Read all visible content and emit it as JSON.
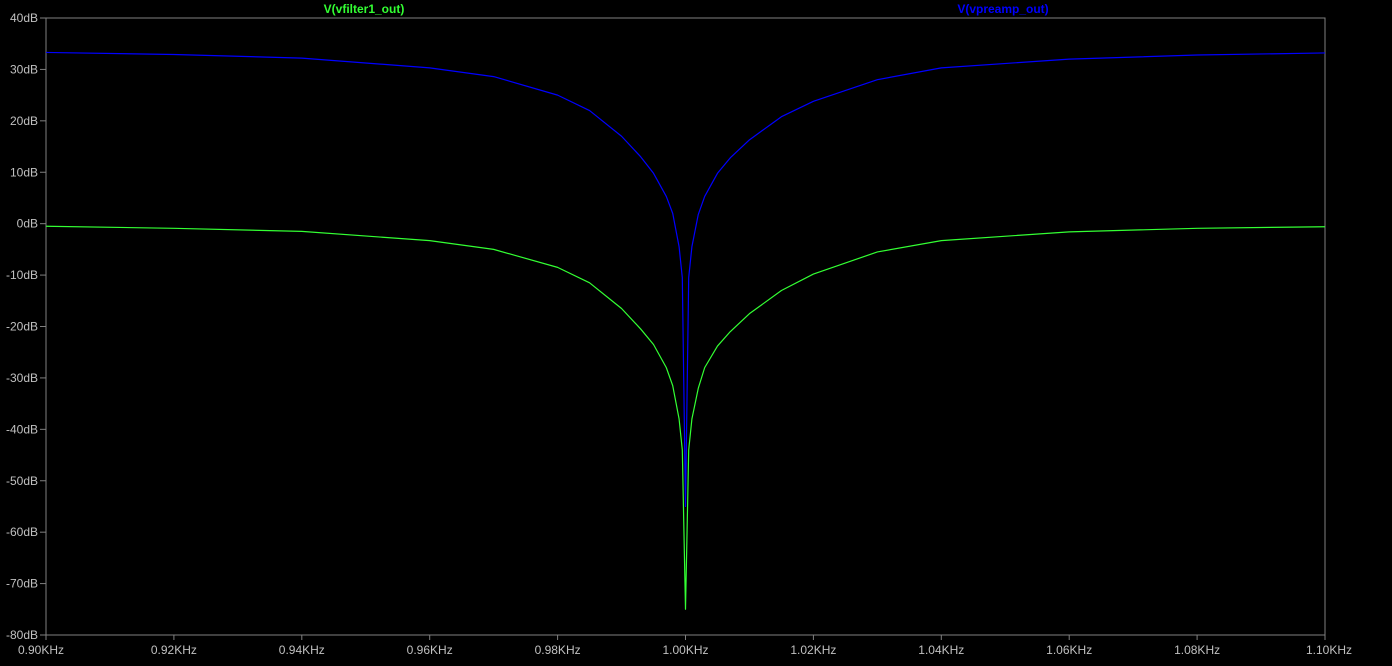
{
  "chart_data": {
    "type": "line",
    "title": "",
    "xlabel": "",
    "ylabel": "",
    "xlim": [
      0.9,
      1.1
    ],
    "ylim": [
      -80,
      40
    ],
    "grid": false,
    "background": "#000000",
    "axis_color": "#808080",
    "tick_color": "#c0c0c0",
    "x_ticks": [
      {
        "value": 0.9,
        "label": "0.90KHz"
      },
      {
        "value": 0.92,
        "label": "0.92KHz"
      },
      {
        "value": 0.94,
        "label": "0.94KHz"
      },
      {
        "value": 0.96,
        "label": "0.96KHz"
      },
      {
        "value": 0.98,
        "label": "0.98KHz"
      },
      {
        "value": 1.0,
        "label": "1.00KHz"
      },
      {
        "value": 1.02,
        "label": "1.02KHz"
      },
      {
        "value": 1.04,
        "label": "1.04KHz"
      },
      {
        "value": 1.06,
        "label": "1.06KHz"
      },
      {
        "value": 1.08,
        "label": "1.08KHz"
      },
      {
        "value": 1.1,
        "label": "1.10KHz"
      }
    ],
    "y_ticks": [
      {
        "value": 40,
        "label": "40dB"
      },
      {
        "value": 30,
        "label": "30dB"
      },
      {
        "value": 20,
        "label": "20dB"
      },
      {
        "value": 10,
        "label": "10dB"
      },
      {
        "value": 0,
        "label": "0dB"
      },
      {
        "value": -10,
        "label": "-10dB"
      },
      {
        "value": -20,
        "label": "-20dB"
      },
      {
        "value": -30,
        "label": "-30dB"
      },
      {
        "value": -40,
        "label": "-40dB"
      },
      {
        "value": -50,
        "label": "-50dB"
      },
      {
        "value": -60,
        "label": "-60dB"
      },
      {
        "value": -70,
        "label": "-70dB"
      },
      {
        "value": -80,
        "label": "-80dB"
      }
    ],
    "series": [
      {
        "name": "V(vfilter1_out)",
        "color": "#33ff33",
        "x": [
          0.9,
          0.92,
          0.94,
          0.96,
          0.97,
          0.98,
          0.985,
          0.99,
          0.993,
          0.995,
          0.997,
          0.998,
          0.999,
          0.9995,
          1.0,
          1.0005,
          1.001,
          1.002,
          1.003,
          1.005,
          1.007,
          1.01,
          1.015,
          1.02,
          1.03,
          1.04,
          1.06,
          1.08,
          1.1
        ],
        "y": [
          -0.5,
          -0.9,
          -1.5,
          -3.3,
          -5.0,
          -8.5,
          -11.5,
          -16.5,
          -20.5,
          -23.5,
          -28.0,
          -31.5,
          -38.0,
          -44.0,
          -75.0,
          -44.0,
          -38.0,
          -32.0,
          -28.0,
          -23.8,
          -21.0,
          -17.5,
          -13.0,
          -9.8,
          -5.5,
          -3.3,
          -1.6,
          -0.9,
          -0.6
        ]
      },
      {
        "name": "V(vpreamp_out)",
        "color": "#0000ff",
        "x": [
          0.9,
          0.92,
          0.94,
          0.96,
          0.97,
          0.98,
          0.985,
          0.99,
          0.993,
          0.995,
          0.997,
          0.998,
          0.999,
          0.9995,
          1.0,
          1.0005,
          1.001,
          1.002,
          1.003,
          1.005,
          1.007,
          1.01,
          1.015,
          1.02,
          1.03,
          1.04,
          1.06,
          1.08,
          1.1
        ],
        "y": [
          33.3,
          32.9,
          32.2,
          30.3,
          28.6,
          25.0,
          22.0,
          17.0,
          13.0,
          9.8,
          5.3,
          2.0,
          -4.5,
          -10.5,
          -55.0,
          -10.5,
          -4.5,
          1.8,
          5.3,
          9.8,
          12.8,
          16.3,
          20.8,
          23.8,
          28.0,
          30.3,
          32.0,
          32.8,
          33.2
        ]
      }
    ]
  }
}
